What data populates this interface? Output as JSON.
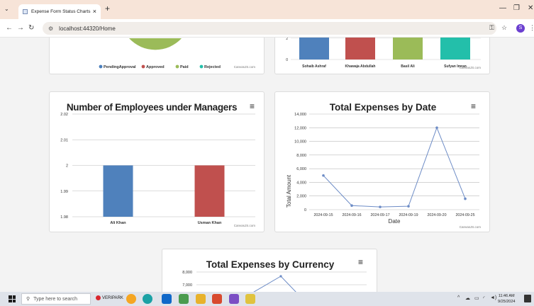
{
  "browser": {
    "tab_title": "Expense Form Status Charts",
    "tab_close": "×",
    "new_tab": "+",
    "url": "localhost:44320/Home",
    "profile_initial": "S"
  },
  "charts": {
    "status_pie": {
      "legend": [
        {
          "label": "PendingApproval",
          "color": "#4a7ebb"
        },
        {
          "label": "Approved",
          "color": "#c0504d"
        },
        {
          "label": "Paid",
          "color": "#9bbb59"
        },
        {
          "label": "Rejected",
          "color": "#23bfaa"
        }
      ],
      "credit": "CanvasJS.com"
    },
    "by_employee": {
      "chart_data": {
        "type": "bar",
        "categories": [
          "Sohaib Ashraf",
          "Khawaja Abdullah",
          "Basil Ali",
          "Sufyan Imran"
        ],
        "colors": [
          "#4f81bc",
          "#c0504e",
          "#9bbb58",
          "#23bfaa"
        ],
        "y_tick_labels": [
          "2",
          "0"
        ]
      },
      "credit": "CanvasJS.com"
    },
    "employees_under_managers": {
      "chart_data": {
        "type": "bar",
        "title": "Number of Employees under Managers",
        "categories": [
          "Ali Khan",
          "Usman Khan"
        ],
        "values": [
          2,
          2
        ],
        "colors": [
          "#4f81bc",
          "#c0504e"
        ],
        "ylim": [
          1.98,
          2.02
        ],
        "yticks": [
          1.98,
          1.99,
          2,
          2.01,
          2.02
        ],
        "y_tick_labels": [
          "1.98",
          "1.99",
          "2",
          "2.01",
          "2.02"
        ]
      },
      "credit": "CanvasJS.com"
    },
    "expenses_by_date": {
      "chart_data": {
        "type": "line",
        "title": "Total Expenses by Date",
        "xlabel": "Date",
        "ylabel": "Total Amount",
        "categories": [
          "2024-09-15",
          "2024-09-16",
          "2024-09-17",
          "2024-09-19",
          "2024-09-20",
          "2024-09-25"
        ],
        "values": [
          5000,
          600,
          400,
          500,
          12000,
          1600
        ],
        "ylim": [
          0,
          14000
        ],
        "yticks": [
          0,
          2000,
          4000,
          6000,
          8000,
          10000,
          12000,
          14000
        ],
        "y_tick_labels": [
          "0",
          "2,000",
          "4,000",
          "6,000",
          "8,000",
          "10,000",
          "12,000",
          "14,000"
        ],
        "color": "#6d8cc6"
      },
      "credit": "CanvasJS.com"
    },
    "expenses_by_currency": {
      "chart_data": {
        "type": "line",
        "title": "Total Expenses by Currency",
        "y_tick_labels": [
          "8,000",
          "7,000"
        ],
        "color": "#6d8cc6"
      }
    }
  },
  "menu_icon": "≡",
  "taskbar": {
    "search_placeholder": "Type here to search",
    "veripark": "VERIPARK",
    "time": "11:46 AM",
    "date": "9/25/2024"
  }
}
